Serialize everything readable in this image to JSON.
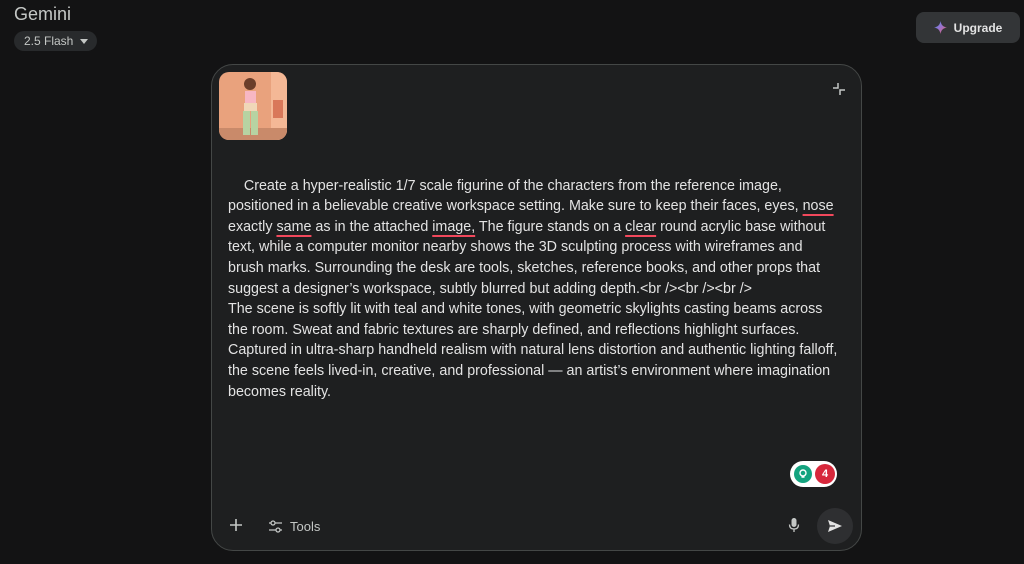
{
  "header": {
    "app_title": "Gemini",
    "model_label": "2.5 Flash",
    "upgrade_label": "Upgrade"
  },
  "composer": {
    "attachment_icon": "image-thumbnail",
    "prompt_segments": [
      {
        "text": "Create a hyper-realistic 1/7 scale figurine of the characters from the reference image, positioned in a believable creative workspace setting. Make sure to keep their faces, eyes, ",
        "flag": false
      },
      {
        "text": "nose",
        "flag": true
      },
      {
        "text": " exactly ",
        "flag": false
      },
      {
        "text": "same",
        "flag": true
      },
      {
        "text": " as in the attached ",
        "flag": false
      },
      {
        "text": "image,",
        "flag": true
      },
      {
        "text": " The figure stands on a ",
        "flag": false
      },
      {
        "text": "clear",
        "flag": true
      },
      {
        "text": " round acrylic base without text, while a computer monitor nearby shows the 3D sculpting process with wireframes and brush marks. Surrounding the desk are tools, sketches, reference books, and other props that suggest a designer’s workspace, subtly blurred but adding depth.<br /><br /><br />\nThe scene is softly lit with teal and white tones, with geometric skylights casting beams across the room. Sweat and fabric textures are sharply defined, and reflections highlight surfaces. Captured in ultra-sharp handheld realism with natural lens distortion and authentic lighting falloff, the scene feels lived-in, creative, and professional — an artist’s environment where imagination becomes reality.",
        "flag": false
      }
    ],
    "grammar_count": "4",
    "tools_label": "Tools"
  },
  "colors": {
    "background": "#131314",
    "panel": "#1e1f20",
    "spell_underline": "#f2485c",
    "grammar_green": "#14a37f",
    "grammar_red": "#d7283c"
  }
}
